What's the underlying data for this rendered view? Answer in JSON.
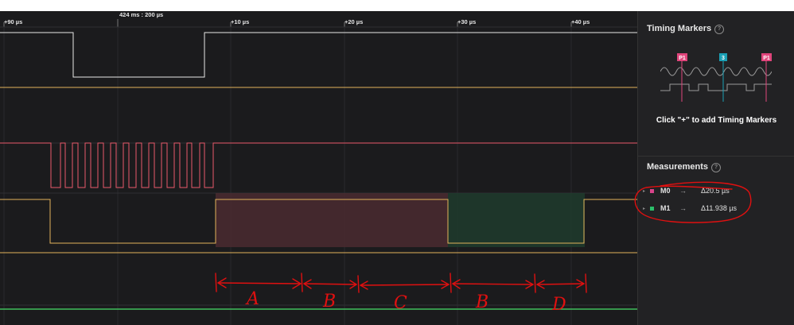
{
  "timeline": {
    "ticks": [
      {
        "label": "+90 µs"
      },
      {
        "label": "424 ms : 200 µs"
      },
      {
        "label": "+10 µs"
      },
      {
        "label": "+20 µs"
      },
      {
        "label": "+30 µs"
      },
      {
        "label": "+40 µs"
      }
    ]
  },
  "channels": [
    {
      "color": "#e8e8e8"
    },
    {
      "color": "#e3b35a"
    },
    {
      "color": "#e85a6a"
    },
    {
      "color": "#e3b35a"
    },
    {
      "color": "#e3b35a"
    },
    {
      "color": "#3fbf5c"
    }
  ],
  "colors": {
    "m0_region": "#4a2a30",
    "m1_region": "#1f3a2c",
    "marker_pink": "#e0457b",
    "marker_teal": "#1ba0b5",
    "annotation": "#e01010"
  },
  "timing_markers": {
    "title": "Timing Markers",
    "help_icon": "question-circle-icon",
    "illustration": {
      "left_marker": "P1",
      "middle_marker": "3",
      "right_marker": "P1"
    },
    "hint": "Click \"+\" to add Timing Markers"
  },
  "measurements": {
    "title": "Measurements",
    "items": [
      {
        "name": "M0",
        "arrow": "→",
        "value": "Δ20.5 µs",
        "color": "#d9448b"
      },
      {
        "name": "M1",
        "arrow": "→",
        "value": "Δ11.938 µs",
        "color": "#2bbf6a"
      }
    ]
  },
  "annotations": {
    "letters": [
      "A",
      "B",
      "C",
      "B",
      "D"
    ]
  }
}
